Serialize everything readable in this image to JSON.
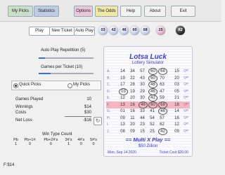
{
  "menu": [
    {
      "label": "My Picks",
      "bg": "#c9dfc9"
    },
    {
      "label": "Statistics",
      "bg": "#bfcbe4"
    },
    {
      "label": "Options",
      "bg": "#e9c6dc"
    },
    {
      "label": "The Odds",
      "bg": "#efe7a6"
    },
    {
      "label": "Help",
      "bg": "#f2f2f2"
    },
    {
      "label": "About",
      "bg": "#f2f2f2"
    },
    {
      "label": "Exit",
      "bg": "#f2f2f2"
    }
  ],
  "toolbar": {
    "play": "Play",
    "new_ticket": "New Ticket",
    "auto_play": "Auto Play"
  },
  "drawn_balls": [
    "03",
    "42",
    "46",
    "60",
    "68"
  ],
  "mega_ball": "25",
  "multiplier": "X2",
  "auto_play_repetition": {
    "label": "Auto Play Repetition (5)",
    "level": 0.12
  },
  "games_per_ticket": {
    "label": "Games per Ticket (10)",
    "level": 0.22
  },
  "pick_mode": {
    "quick": "Quick Picks",
    "mine": "My Picks",
    "selected": "quick"
  },
  "stats": {
    "games_played_label": "Games Played",
    "games_played": "10",
    "winnings_label": "Winnings",
    "winnings": "$14",
    "costs_label": "Costs",
    "costs": "$30",
    "net_loss_label": "Net Loss",
    "net_loss": "-$16"
  },
  "win_type": {
    "title": "Win Type Count",
    "headers": [
      "Pb",
      "Pb+1#",
      "Pb+2#'s",
      "3#'s",
      "4#'s",
      "5#'s"
    ],
    "values": [
      "1",
      "0",
      "0",
      "1",
      "0",
      "0"
    ]
  },
  "status_text": "F:$14",
  "ticket": {
    "title": "Lotsa Luck",
    "subtitle": "Lottery Simulator",
    "rows": [
      {
        "l": "A.",
        "n": [
          "14",
          "34",
          "57",
          "60",
          "68"
        ],
        "m": "15",
        "hits": [
          false,
          false,
          false,
          true,
          true
        ]
      },
      {
        "l": "B.",
        "n": [
          "19",
          "22",
          "43",
          "60",
          "70"
        ],
        "m": "20",
        "hits": [
          false,
          false,
          false,
          true,
          false
        ]
      },
      {
        "l": "C.",
        "n": [
          "17",
          "28",
          "30",
          "46",
          "63"
        ],
        "m": "03",
        "hits": [
          false,
          false,
          false,
          true,
          false
        ]
      },
      {
        "l": "D.",
        "n": [
          "03",
          "19",
          "29",
          "46",
          "47"
        ],
        "m": "05",
        "hits": [
          true,
          false,
          false,
          true,
          false
        ]
      },
      {
        "l": "E.",
        "n": [
          "12",
          "20",
          "30",
          "42",
          "59"
        ],
        "m": "21",
        "hits": [
          false,
          false,
          false,
          true,
          false
        ]
      },
      {
        "l": "F.",
        "n": [
          "13",
          "16",
          "46",
          "60",
          "68"
        ],
        "m": "18",
        "hits": [
          false,
          false,
          true,
          true,
          true
        ],
        "sel": true
      },
      {
        "l": "G.",
        "n": [
          "01",
          "16",
          "33",
          "41",
          "46"
        ],
        "m": "14",
        "hits": [
          false,
          false,
          false,
          false,
          true
        ]
      },
      {
        "l": "H.",
        "n": [
          "09",
          "11",
          "44",
          "54",
          "57"
        ],
        "m": "16",
        "hits": [
          false,
          false,
          false,
          false,
          false
        ]
      },
      {
        "l": "I.",
        "n": [
          "13",
          "20",
          "23",
          "52",
          "62"
        ],
        "m": "12",
        "hits": [
          false,
          false,
          false,
          false,
          false
        ]
      },
      {
        "l": "J.",
        "n": [
          "08",
          "09",
          "15",
          "25",
          "42"
        ],
        "m": "09",
        "hits": [
          false,
          false,
          false,
          false,
          true
        ]
      }
    ],
    "qp": "QP",
    "multi": "== Multi X Play ==",
    "jackpot": "$50 Zillion",
    "date": "Mon. Sep 14 2020",
    "cost": "Ticket Cost $20.00"
  }
}
